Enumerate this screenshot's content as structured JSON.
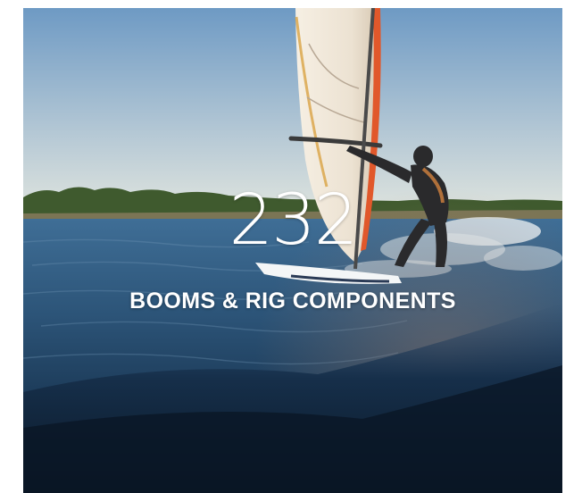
{
  "tile": {
    "count": "232",
    "title": "BOOMS & RIG COMPONENTS"
  },
  "photo": {
    "subject": "windsurfer-on-water",
    "colors": {
      "sky_top": "#6e9ac4",
      "sky_bottom": "#dbe3e2",
      "water_dark": "#10263f",
      "water_mid": "#2f5b80",
      "sail": "#f1e9dd",
      "sail_accent": "#e1582b",
      "wetsuit": "#2a2a2c"
    }
  }
}
